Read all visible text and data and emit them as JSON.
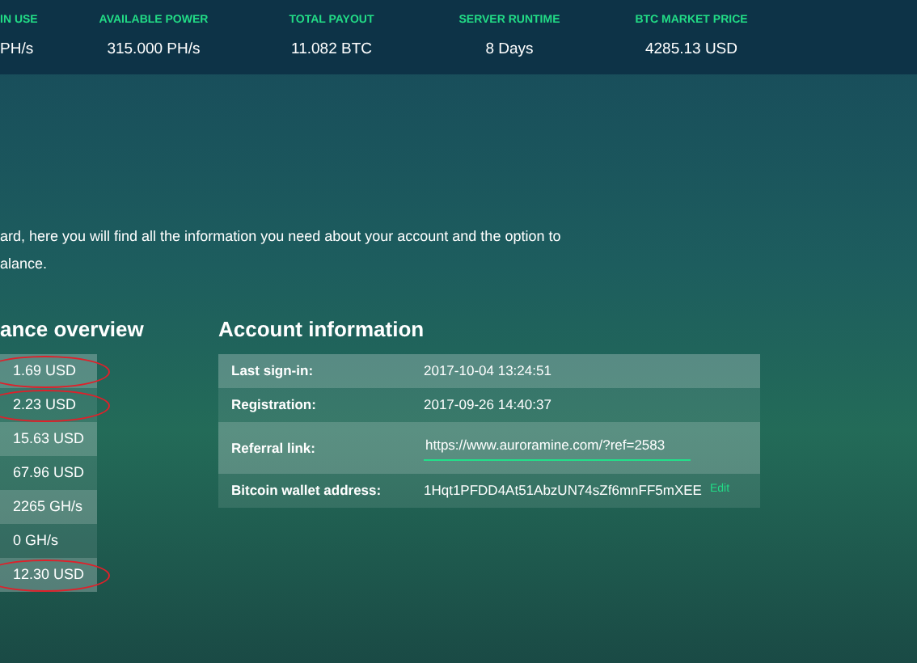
{
  "stats": [
    {
      "label": "IN USE",
      "value": "PH/s"
    },
    {
      "label": "AVAILABLE POWER",
      "value": "315.000 PH/s"
    },
    {
      "label": "TOTAL PAYOUT",
      "value": "11.082 BTC"
    },
    {
      "label": "SERVER RUNTIME",
      "value": "8 Days"
    },
    {
      "label": "BTC MARKET PRICE",
      "value": "4285.13 USD"
    }
  ],
  "intro": {
    "line_1": "ard, here you will find all the information you need about your account and the option to",
    "line_2": "alance."
  },
  "balance": {
    "title": "ance overview",
    "rows": [
      {
        "value": "1.69 USD",
        "circled": true
      },
      {
        "value": "2.23 USD",
        "circled": true
      },
      {
        "value": "15.63 USD",
        "circled": false
      },
      {
        "value": "67.96 USD",
        "circled": false
      },
      {
        "value": "2265 GH/s",
        "circled": false
      },
      {
        "value": "0 GH/s",
        "circled": false
      },
      {
        "value": "12.30 USD",
        "circled": true
      }
    ]
  },
  "account": {
    "title": "Account information",
    "rows": [
      {
        "kind": "text",
        "label": "Last sign-in:",
        "value": "2017-10-04 13:24:51"
      },
      {
        "kind": "text",
        "label": "Registration:",
        "value": "2017-09-26 14:40:37"
      },
      {
        "kind": "input",
        "label": "Referral link:",
        "value": "https://www.auroramine.com/?ref=2583"
      },
      {
        "kind": "wallet",
        "label": "Bitcoin wallet address:",
        "value": "1Hqt1PFDD4At51AbzUN74sZf6mnFF5mXEE",
        "link": "Edit"
      }
    ]
  }
}
